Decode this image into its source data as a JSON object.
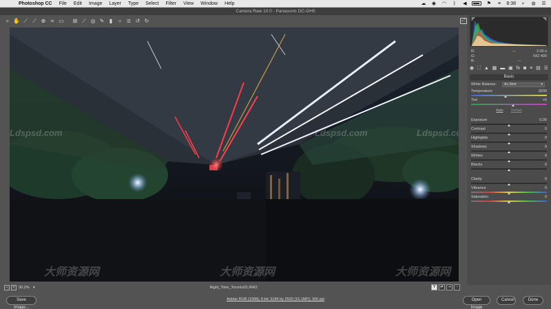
{
  "menubar": {
    "apple": "",
    "app_name": "Photoshop CC",
    "items": [
      "File",
      "Edit",
      "Image",
      "Layer",
      "Type",
      "Select",
      "Filter",
      "View",
      "Window",
      "Help"
    ],
    "clock": "8:38"
  },
  "window": {
    "title": "Camera Raw 10.0  -  Panasonic DC-GH5"
  },
  "preview": {
    "watermarks": [
      "Ldspsd.com",
      "Ldspsd.com",
      "Ldspsd.com",
      "大师资源网",
      "大师资源网",
      "大师资源网"
    ],
    "watermark_sub": "www.Ldspsd.com"
  },
  "info": {
    "r_label": "R:",
    "g_label": "G:",
    "b_label": "B:",
    "f_stop": "---",
    "shutter": "2.00 s",
    "iso": "ISO 400",
    "lens": "---"
  },
  "panel": {
    "header": "Basic",
    "white_balance_label": "White Balance:",
    "white_balance_value": "As Shot",
    "auto_label": "Auto",
    "default_label": "Default",
    "sliders": [
      {
        "label": "Temperature",
        "value": "3200"
      },
      {
        "label": "Tint",
        "value": "+5"
      },
      {
        "label": "Exposure",
        "value": "0.00"
      },
      {
        "label": "Contrast",
        "value": "0"
      },
      {
        "label": "Highlights",
        "value": "0"
      },
      {
        "label": "Shadows",
        "value": "0"
      },
      {
        "label": "Whites",
        "value": "0"
      },
      {
        "label": "Blacks",
        "value": "0"
      },
      {
        "label": "Clarity",
        "value": "0"
      },
      {
        "label": "Vibrance",
        "value": "0"
      },
      {
        "label": "Saturation",
        "value": "0"
      }
    ],
    "slider_positions": [
      0.45,
      0.55,
      0.5,
      0.5,
      0.5,
      0.5,
      0.5,
      0.5,
      0.5,
      0.5,
      0.5
    ]
  },
  "status": {
    "zoom": "30.2%",
    "filename": "Night_Time_Toronto01.RW2",
    "y_label": "Y"
  },
  "footer": {
    "save": "Save Image...",
    "workflow": "Adobe RGB (1998); 8 bit; 5184 by 2920 (15.1MP); 300 ppi",
    "open": "Open Image",
    "cancel": "Cancel",
    "done": "Done"
  },
  "colors": {
    "accent": "#e8e8e8",
    "panel": "#4b4b4b",
    "chrome": "#535353"
  }
}
